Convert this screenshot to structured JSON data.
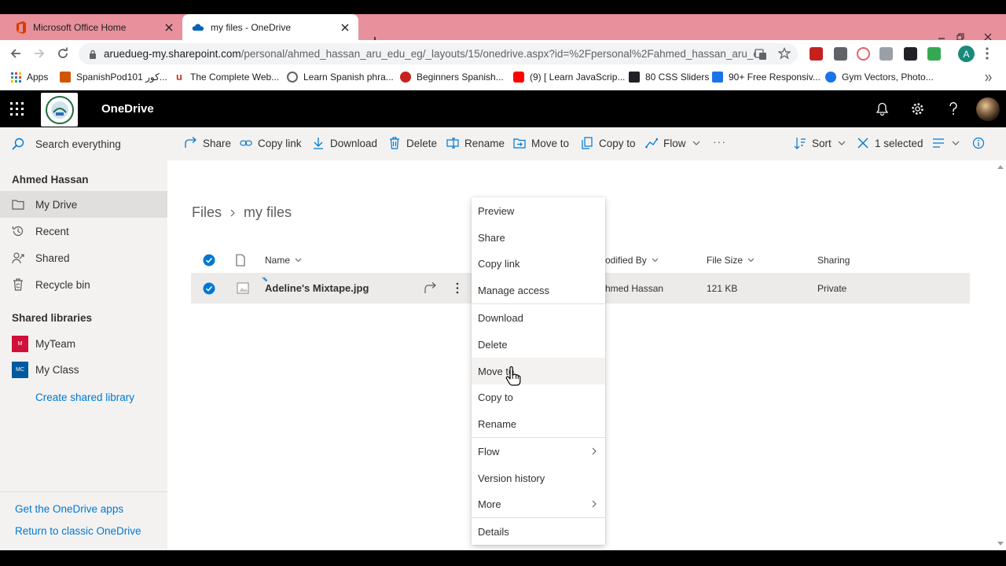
{
  "browser": {
    "tabs": [
      {
        "title": "Microsoft Office Home",
        "active": false
      },
      {
        "title": "my files - OneDrive",
        "active": true
      }
    ],
    "url_host": "aruedueg-my.sharepoint.com",
    "url_path": "/personal/ahmed_hassan_aru_edu_eg/_layouts/15/onedrive.aspx?id=%2Fpersonal%2Fahmed_hassan_aru_edu...",
    "profile_initial": "A",
    "bookmarks": [
      "Apps",
      "SpanishPod101 كور...",
      "The Complete Web...",
      "Learn Spanish phra...",
      "Beginners Spanish...",
      "(9) [ Learn JavaScrip...",
      "80 CSS Sliders",
      "90+ Free Responsiv...",
      "Gym Vectors, Photo..."
    ]
  },
  "suite": {
    "app_name": "OneDrive"
  },
  "commandbar": {
    "search_placeholder": "Search everything",
    "share": "Share",
    "copy_link": "Copy link",
    "download": "Download",
    "delete": "Delete",
    "rename": "Rename",
    "move_to": "Move to",
    "copy_to": "Copy to",
    "flow": "Flow",
    "more": "···",
    "sort": "Sort",
    "selected": "1 selected"
  },
  "leftnav": {
    "user": "Ahmed Hassan",
    "items": [
      "My Drive",
      "Recent",
      "Shared",
      "Recycle bin"
    ],
    "shared_libraries_heading": "Shared libraries",
    "libraries": [
      {
        "name": "MyTeam",
        "tile": "M",
        "color": "#d0103a"
      },
      {
        "name": "My Class",
        "tile": "MC",
        "color": "#005a9e"
      }
    ],
    "create_library": "Create shared library",
    "get_apps": "Get the OneDrive apps",
    "return_classic": "Return to classic OneDrive"
  },
  "main": {
    "breadcrumb_root": "Files",
    "breadcrumb_current": "my files",
    "columns": {
      "name": "Name",
      "modified_by": "odified By",
      "file_size": "File Size",
      "sharing": "Sharing"
    },
    "rows": [
      {
        "name": "Adeline's Mixtape.jpg",
        "modified_by": "hmed Hassan",
        "file_size": "121 KB",
        "sharing": "Private"
      }
    ]
  },
  "context_menu": [
    "Preview",
    "Share",
    "Copy link",
    "Manage access",
    "Download",
    "Delete",
    "Move to",
    "Copy to",
    "Rename",
    "Flow",
    "Version history",
    "More",
    "Details"
  ],
  "colors": {
    "accent": "#0078d4",
    "tabstrip": "#e8909b",
    "suitebar": "#000000"
  }
}
